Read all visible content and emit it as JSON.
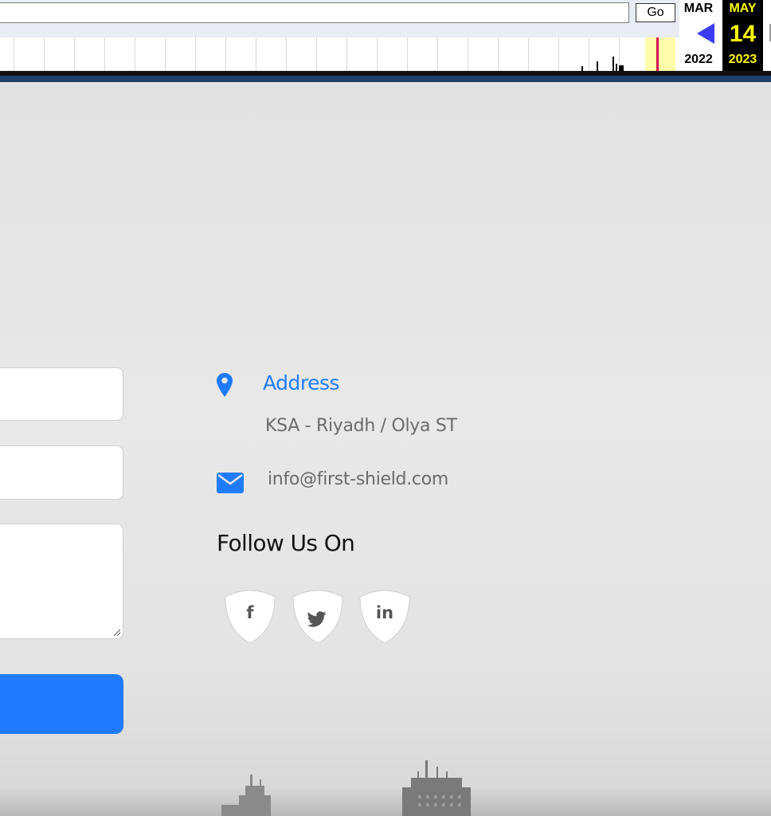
{
  "wayback": {
    "go_label": "Go",
    "prev_capture": {
      "month": "MAR",
      "year": "2022"
    },
    "current_capture": {
      "month": "MAY",
      "day": "14",
      "year": "2023"
    },
    "colors": {
      "current_bg": "#000000",
      "current_text": "#fefe00",
      "prev_arrow": "#3c3cf5",
      "highlight": "#fdfdaa",
      "marker": "#d4124e"
    }
  },
  "contact": {
    "address_title": "Address",
    "address_text": "KSA - Riyadh / Olya ST",
    "email": "info@first-shield.com",
    "follow_title": "Follow Us On",
    "icons": {
      "address": "map-pin-icon",
      "email": "envelope-icon"
    }
  },
  "social": [
    {
      "name": "facebook",
      "glyph": "f"
    },
    {
      "name": "twitter",
      "glyph": "twitter-bird-icon"
    },
    {
      "name": "linkedin",
      "glyph": "in"
    }
  ],
  "theme": {
    "accent": "#1f7bff",
    "text_muted": "#6b6b6b",
    "heading": "#111111"
  }
}
